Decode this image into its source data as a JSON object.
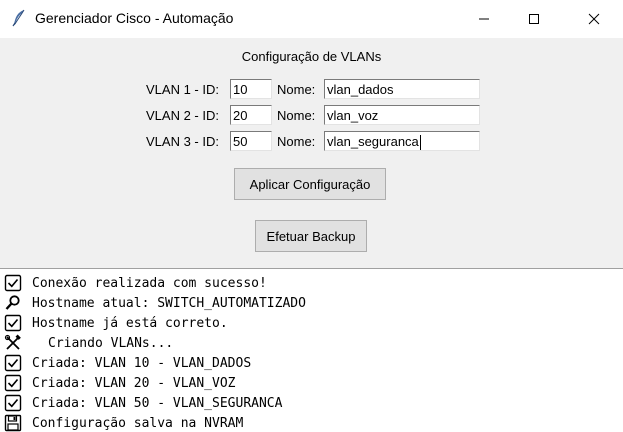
{
  "window": {
    "title": "Gerenciador Cisco - Automação",
    "icon": "feather-icon"
  },
  "config": {
    "section_title": "Configuração de VLANs",
    "id_label_suffix": " - ID:",
    "name_label": "Nome:",
    "vlans": [
      {
        "label": "VLAN 1 - ID:",
        "id": "10",
        "name": "vlan_dados"
      },
      {
        "label": "VLAN 2 - ID:",
        "id": "20",
        "name": "vlan_voz"
      },
      {
        "label": "VLAN 3 - ID:",
        "id": "50",
        "name": "vlan_seguranca"
      }
    ]
  },
  "buttons": {
    "apply": "Aplicar Configuração",
    "backup": "Efetuar Backup"
  },
  "log": {
    "lines": [
      {
        "icon": "checkbox-icon",
        "text": "Conexão realizada com sucesso!"
      },
      {
        "icon": "magnifier-icon",
        "text": "Hostname atual: SWITCH_AUTOMATIZADO"
      },
      {
        "icon": "checkbox-icon",
        "text": "Hostname já está correto."
      },
      {
        "icon": "tools-icon",
        "text": "Criando VLANs..."
      },
      {
        "icon": "checkbox-icon",
        "text": "Criada: VLAN 10 - VLAN_DADOS"
      },
      {
        "icon": "checkbox-icon",
        "text": "Criada: VLAN 20 - VLAN_VOZ"
      },
      {
        "icon": "checkbox-icon",
        "text": "Criada: VLAN 50 - VLAN_SEGURANCA"
      },
      {
        "icon": "floppy-disk-icon",
        "text": "Configuração salva na NVRAM"
      }
    ]
  }
}
